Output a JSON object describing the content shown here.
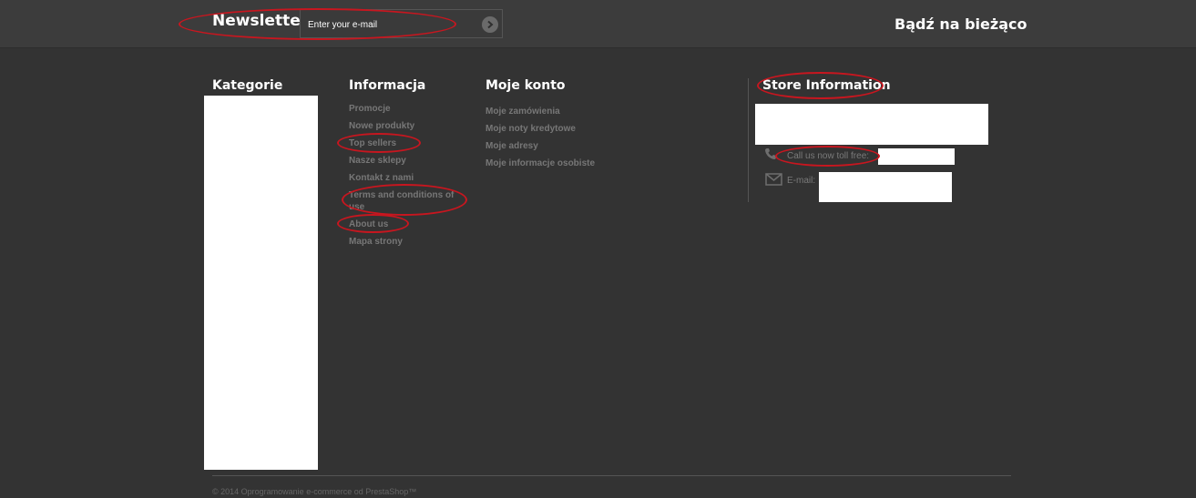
{
  "newsletter": {
    "title": "Newsletter",
    "input_placeholder": "Enter your e-mail"
  },
  "social": {
    "title": "Bądź na bieżąco"
  },
  "columns": {
    "categories": {
      "title": "Kategorie"
    },
    "information": {
      "title": "Informacja",
      "items": [
        "Promocje",
        "Nowe produkty",
        "Top sellers",
        "Nasze sklepy",
        "Kontakt z nami",
        "Terms and conditions of use",
        "About us",
        "Mapa strony"
      ]
    },
    "account": {
      "title": "Moje konto",
      "items": [
        "Moje zamówienia",
        "Moje noty kredytowe",
        "Moje adresy",
        "Moje informacje osobiste"
      ]
    },
    "store": {
      "title": "Store Information",
      "phone_label": "Call us now toll free:",
      "email_label": "E-mail:"
    }
  },
  "footer": {
    "copyright": "© 2014 Oprogramowanie e-commerce od PrestaShop™"
  },
  "colors": {
    "background": "#333333",
    "topbar": "#3c3c3c",
    "annotation": "#c8161f"
  }
}
